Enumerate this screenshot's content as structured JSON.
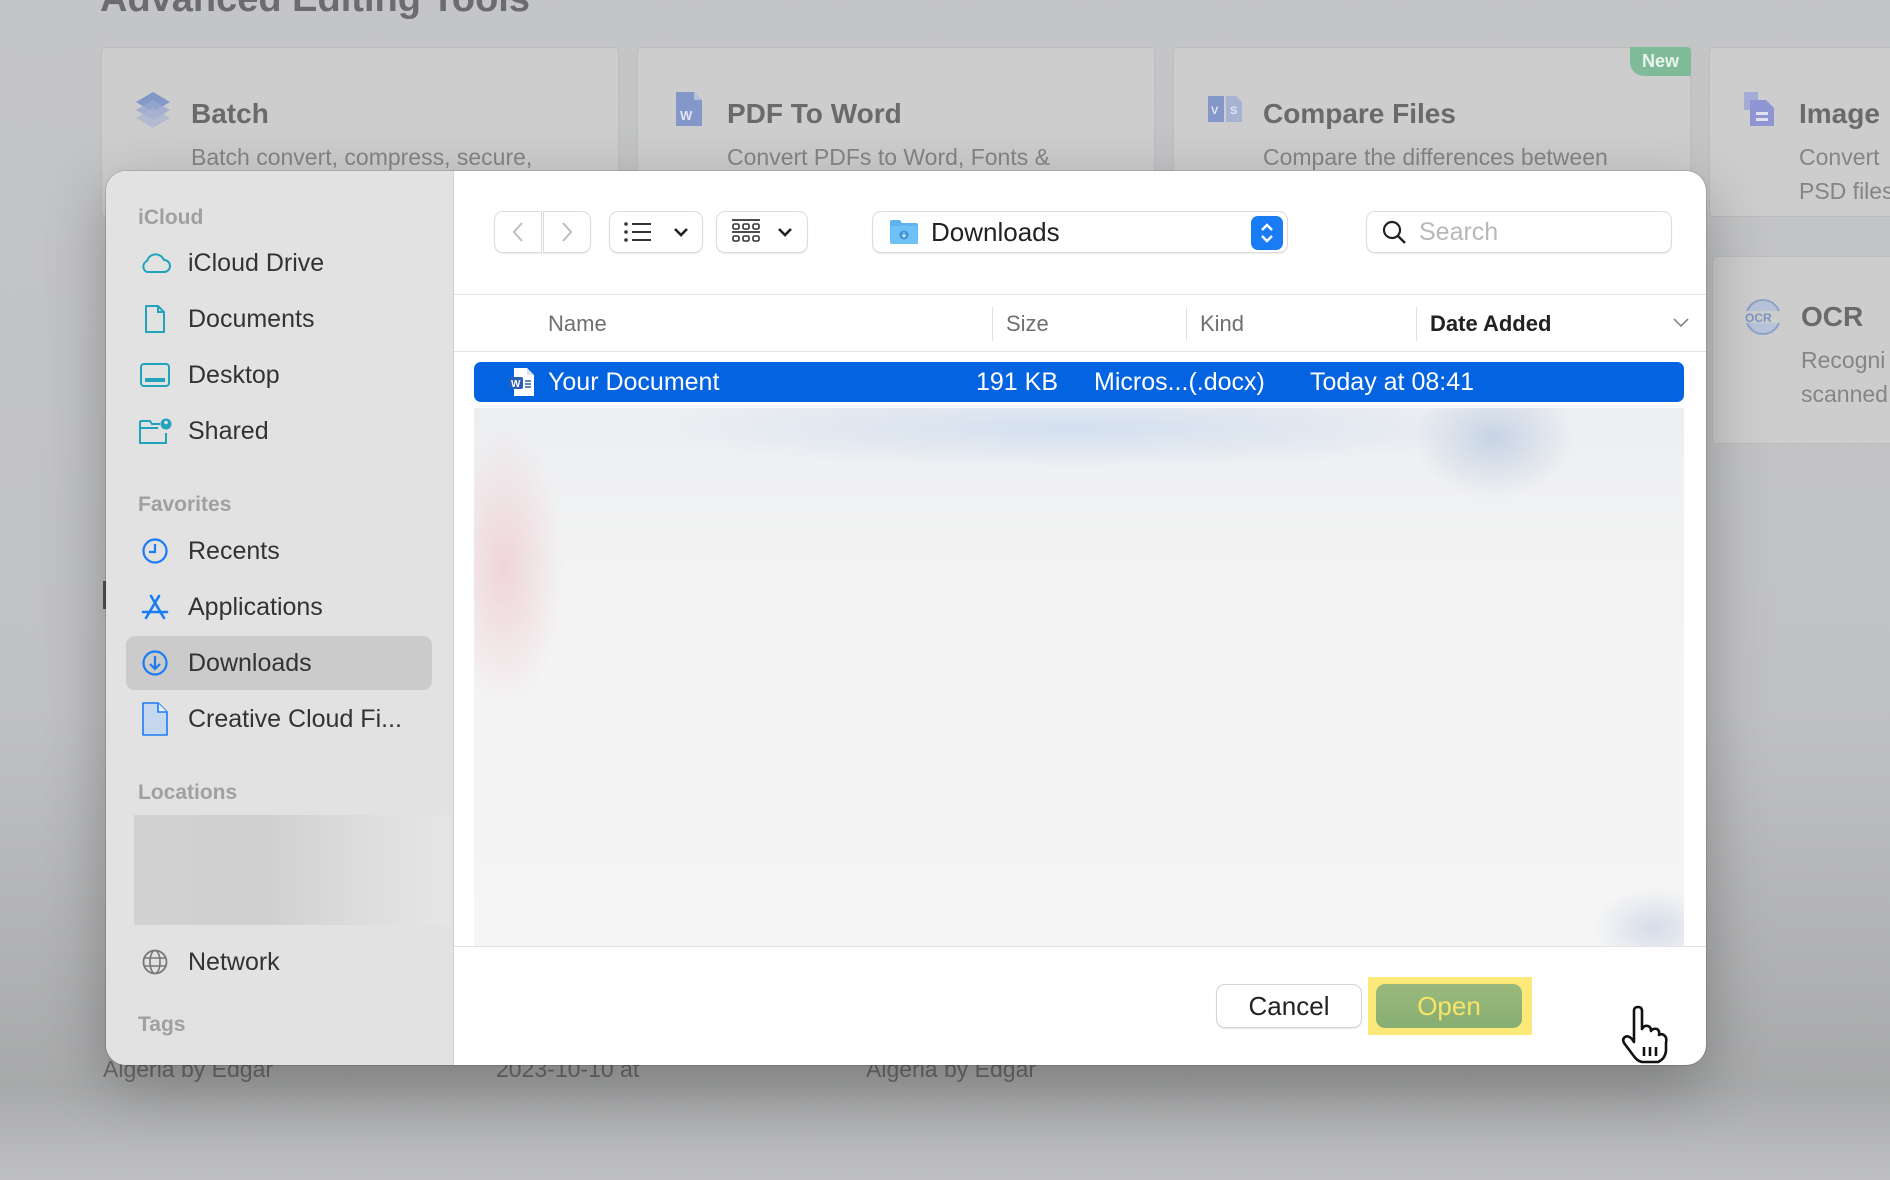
{
  "background": {
    "section_title": "Advanced Editing Tools",
    "tools": [
      {
        "name": "Batch",
        "description": "Batch convert, compress, secure,",
        "icon": "layers-icon"
      },
      {
        "name": "PDF To Word",
        "description": "Convert PDFs to Word, Fonts &",
        "icon": "word-file-icon"
      },
      {
        "name": "Compare Files",
        "description": "Compare the differences between",
        "icon": "compare-icon",
        "badge": "New"
      },
      {
        "name": "Image",
        "description": "Convert\nPSD files",
        "icon": "image-file-icon"
      }
    ],
    "ocr": {
      "name": "OCR",
      "description": "Recogni\nscanned",
      "icon": "ocr-icon"
    },
    "row": {
      "name": "Algeria by Edgar",
      "date": "2023-10-10 at",
      "author": "Algeria by Edgar"
    }
  },
  "dialog": {
    "sidebar": {
      "sections": [
        {
          "title": "iCloud",
          "items": [
            {
              "label": "iCloud Drive",
              "icon": "cloud-icon"
            },
            {
              "label": "Documents",
              "icon": "document-icon"
            },
            {
              "label": "Desktop",
              "icon": "desktop-icon"
            },
            {
              "label": "Shared",
              "icon": "shared-folder-icon"
            }
          ]
        },
        {
          "title": "Favorites",
          "items": [
            {
              "label": "Recents",
              "icon": "clock-icon"
            },
            {
              "label": "Applications",
              "icon": "applications-icon"
            },
            {
              "label": "Downloads",
              "icon": "download-icon",
              "selected": true
            },
            {
              "label": "Creative Cloud Fi...",
              "icon": "file-icon"
            }
          ]
        },
        {
          "title": "Locations",
          "items": [
            {
              "label": "Network",
              "icon": "globe-icon"
            }
          ]
        },
        {
          "title": "Tags",
          "items": []
        }
      ]
    },
    "toolbar": {
      "current_folder": "Downloads",
      "search_placeholder": "Search",
      "search_value": ""
    },
    "columns": [
      "Name",
      "Size",
      "Kind",
      "Date Added"
    ],
    "sorted_column": "Date Added",
    "files": [
      {
        "name": "Your Document",
        "size": "191 KB",
        "kind": "Micros...(.docx)",
        "date_added": "Today at 08:41",
        "selected": true
      }
    ],
    "buttons": {
      "cancel": "Cancel",
      "open": "Open"
    }
  }
}
